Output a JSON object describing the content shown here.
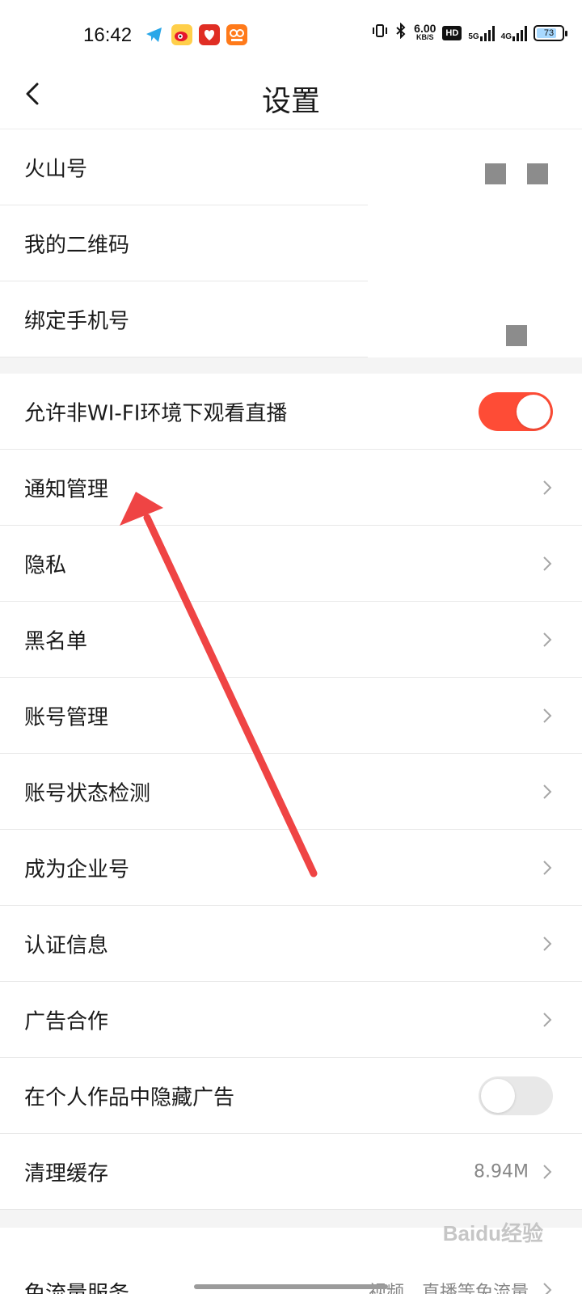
{
  "status_bar": {
    "time": "16:42",
    "net_speed_value": "6.00",
    "net_speed_unit": "KB/S",
    "hd_badge": "HD",
    "net_5g": "5G",
    "net_4g": "4G",
    "battery": "73",
    "app_icons": [
      "telegram-icon",
      "weibo-icon",
      "pinduoduo-icon",
      "meituan-icon"
    ]
  },
  "nav": {
    "title": "设置"
  },
  "account_section": [
    {
      "label": "火山号"
    },
    {
      "label": "我的二维码"
    },
    {
      "label": "绑定手机号"
    }
  ],
  "settings_section": {
    "wifi_live": {
      "label": "允许非WI-FI环境下观看直播",
      "toggle_on": true
    },
    "items": [
      {
        "label": "通知管理"
      },
      {
        "label": "隐私"
      },
      {
        "label": "黑名单"
      },
      {
        "label": "账号管理"
      },
      {
        "label": "账号状态检测"
      },
      {
        "label": "成为企业号"
      },
      {
        "label": "认证信息"
      },
      {
        "label": "广告合作"
      }
    ],
    "hide_ads": {
      "label": "在个人作品中隐藏广告",
      "toggle_on": false
    },
    "clear_cache": {
      "label": "清理缓存",
      "value": "8.94M"
    }
  },
  "free_traffic": {
    "label": "免流量服务",
    "value": "视频、直播等免流量"
  },
  "watermark": "Baidu经验",
  "colors": {
    "accent": "#fe4c36",
    "arrow": "#ef4444",
    "divider": "#e8e8e8",
    "section_gap": "#f4f4f4"
  }
}
